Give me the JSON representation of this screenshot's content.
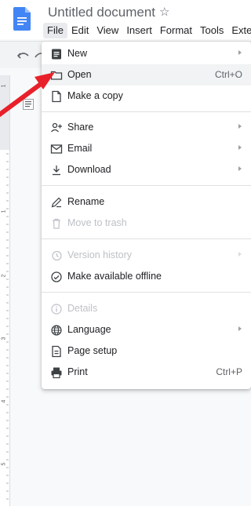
{
  "app": {
    "title": "Untitled document",
    "star_icon": "star-outline-icon",
    "brand_color": "#4285f4"
  },
  "menubar": {
    "items": [
      "File",
      "Edit",
      "View",
      "Insert",
      "Format",
      "Tools",
      "Exter"
    ],
    "active": "File"
  },
  "file_menu": {
    "items": [
      {
        "label": "New",
        "icon": "new-document-icon",
        "submenu": true
      },
      {
        "label": "Open",
        "icon": "folder-icon",
        "shortcut": "Ctrl+O",
        "highlighted": true
      },
      {
        "label": "Make a copy",
        "icon": "copy-icon"
      },
      {
        "label": "Share",
        "icon": "share-person-icon",
        "submenu": true
      },
      {
        "label": "Email",
        "icon": "email-icon",
        "submenu": true
      },
      {
        "label": "Download",
        "icon": "download-icon",
        "submenu": true
      },
      {
        "label": "Rename",
        "icon": "rename-pencil-icon"
      },
      {
        "label": "Move to trash",
        "icon": "trash-icon",
        "disabled": true
      },
      {
        "label": "Version history",
        "icon": "history-icon",
        "submenu": true,
        "disabled": true
      },
      {
        "label": "Make available offline",
        "icon": "offline-check-icon"
      },
      {
        "label": "Details",
        "icon": "info-icon",
        "disabled": true
      },
      {
        "label": "Language",
        "icon": "globe-icon",
        "submenu": true
      },
      {
        "label": "Page setup",
        "icon": "page-setup-icon"
      },
      {
        "label": "Print",
        "icon": "printer-icon",
        "shortcut": "Ctrl+P"
      }
    ]
  },
  "ruler": {
    "numbers": [
      "1",
      "1",
      "2",
      "3",
      "4",
      "5"
    ]
  },
  "annotation": {
    "arrow_color": "#e8202a"
  }
}
